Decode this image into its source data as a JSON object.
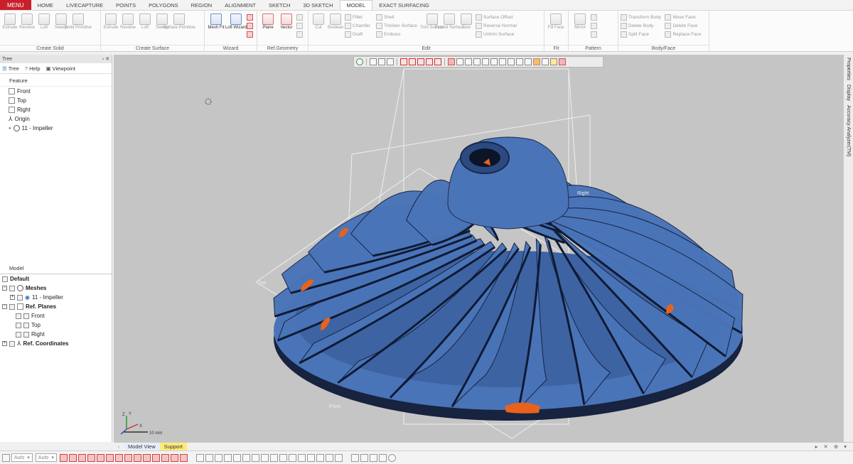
{
  "menu": {
    "label": "MENU"
  },
  "tabs": [
    {
      "label": "HOME"
    },
    {
      "label": "LIVECAPTURE"
    },
    {
      "label": "POINTS"
    },
    {
      "label": "POLYGONS"
    },
    {
      "label": "REGION"
    },
    {
      "label": "ALIGNMENT"
    },
    {
      "label": "SKETCH"
    },
    {
      "label": "3D SKETCH"
    },
    {
      "label": "MODEL",
      "active": true
    },
    {
      "label": "EXACT SURFACING"
    }
  ],
  "ribbon": {
    "create_solid": {
      "label": "Create Solid",
      "tools": [
        "Extrude",
        "Revolve",
        "Loft",
        "Sweep",
        "Solid Primitive"
      ]
    },
    "create_surface": {
      "label": "Create Surface",
      "tools": [
        "Extrude",
        "Revolve",
        "Loft",
        "Sweep",
        "Surface Primitive"
      ]
    },
    "wizard": {
      "label": "Wizard",
      "tools": [
        "Mesh Fit",
        "Loft Wizard"
      ]
    },
    "ref_geometry": {
      "label": "Ref.Geometry",
      "tools": [
        "Plane",
        "Vector"
      ]
    },
    "edit": {
      "label": "Edit",
      "tools": [
        "Cut",
        "Boolean"
      ],
      "stack1": [
        "Fillet",
        "Chamfer",
        "Draft"
      ],
      "stack2": [
        "Shell",
        "Thicken Surface",
        "Emboss"
      ],
      "tools2": [
        "Trim Surface",
        "Extend Surface",
        "Sew"
      ],
      "stack3": [
        "Surface Offset",
        "Reverse Normal",
        "Untrim Surface"
      ]
    },
    "fit": {
      "label": "Fit",
      "tools": [
        "Fill Face"
      ]
    },
    "pattern": {
      "label": "Pattern",
      "tools": [
        "Mirror"
      ]
    },
    "bodyface": {
      "label": "Body/Face",
      "stack1": [
        "Transform Body",
        "Delete Body",
        "Split Face"
      ],
      "stack2": [
        "Move Face",
        "Delete Face",
        "Replace Face"
      ]
    }
  },
  "left_panel": {
    "header": "Tree",
    "header_controls": "▫ ✕",
    "tabs": [
      "Tree",
      "Help",
      "Viewpoint"
    ],
    "feature_title": "Feature",
    "features": [
      "Front",
      "Top",
      "Right",
      "Origin",
      "11 - Impeller"
    ],
    "model_title": "Model",
    "model_tree": {
      "default": "Default",
      "meshes": "Meshes",
      "mesh_item": "11 - Impeller",
      "ref_planes": "Ref. Planes",
      "planes": [
        "Front",
        "Top",
        "Right"
      ],
      "ref_coordinates": "Ref. Coordinates"
    }
  },
  "viewport": {
    "background": "#c5c5c5",
    "mesh_color": "#4a74b8",
    "highlight_color": "#e8621c",
    "plane_labels": {
      "top": "Top",
      "front": "Front",
      "right": "Right"
    },
    "scale_label": "10 mm",
    "triad_labels": {
      "x": "X",
      "y": "Y",
      "z": "Z"
    }
  },
  "right_dock": [
    "Properties",
    "Display",
    "Accuracy Analyzer(TM)"
  ],
  "bottom_tabs": {
    "model_view": "Model View",
    "support": "Support",
    "right_controls": "▸ ✕ ⊕ ▾"
  },
  "statusbar": {
    "selector1": "Auto",
    "selector2": "Auto"
  }
}
